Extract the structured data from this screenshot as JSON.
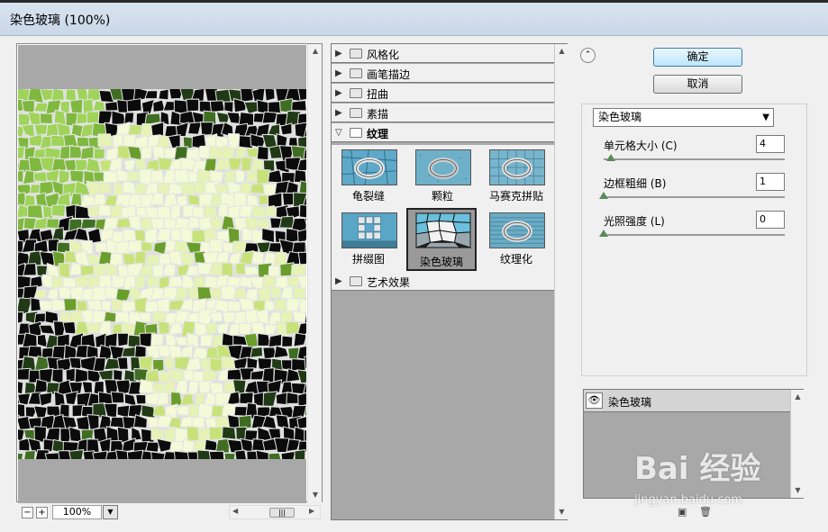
{
  "window": {
    "title": "染色玻璃 (100%)"
  },
  "preview": {
    "zoom": "100%",
    "zoom_out": "−",
    "zoom_in": "+"
  },
  "gallery": {
    "categories": [
      {
        "label": "风格化",
        "expanded": false
      },
      {
        "label": "画笔描边",
        "expanded": false
      },
      {
        "label": "扭曲",
        "expanded": false
      },
      {
        "label": "素描",
        "expanded": false
      },
      {
        "label": "纹理",
        "expanded": true
      },
      {
        "label": "艺术效果",
        "expanded": false
      }
    ],
    "texture_filters": [
      {
        "label": "龟裂缝",
        "selected": false
      },
      {
        "label": "颗粒",
        "selected": false
      },
      {
        "label": "马赛克拼贴",
        "selected": false
      },
      {
        "label": "拼缀图",
        "selected": false
      },
      {
        "label": "染色玻璃",
        "selected": true
      },
      {
        "label": "纹理化",
        "selected": false
      }
    ]
  },
  "buttons": {
    "ok": "确定",
    "cancel": "取消"
  },
  "settings": {
    "filter_select": "染色玻璃",
    "params": [
      {
        "label": "单元格大小 (C)",
        "value": "4",
        "level": 0.04
      },
      {
        "label": "边框粗细 (B)",
        "value": "1",
        "level": 0.0
      },
      {
        "label": "光照强度 (L)",
        "value": "0",
        "level": 0.0
      }
    ]
  },
  "layers": {
    "items": [
      {
        "name": "染色玻璃",
        "visible": true
      }
    ]
  },
  "watermark": {
    "main": "Bai 经验",
    "sub": "jingyan.baidu.com"
  },
  "colors": {
    "accent": "#3c7fb1",
    "gallery_bg": "#a8a8a8",
    "panel_bg": "#f0f0f0"
  }
}
